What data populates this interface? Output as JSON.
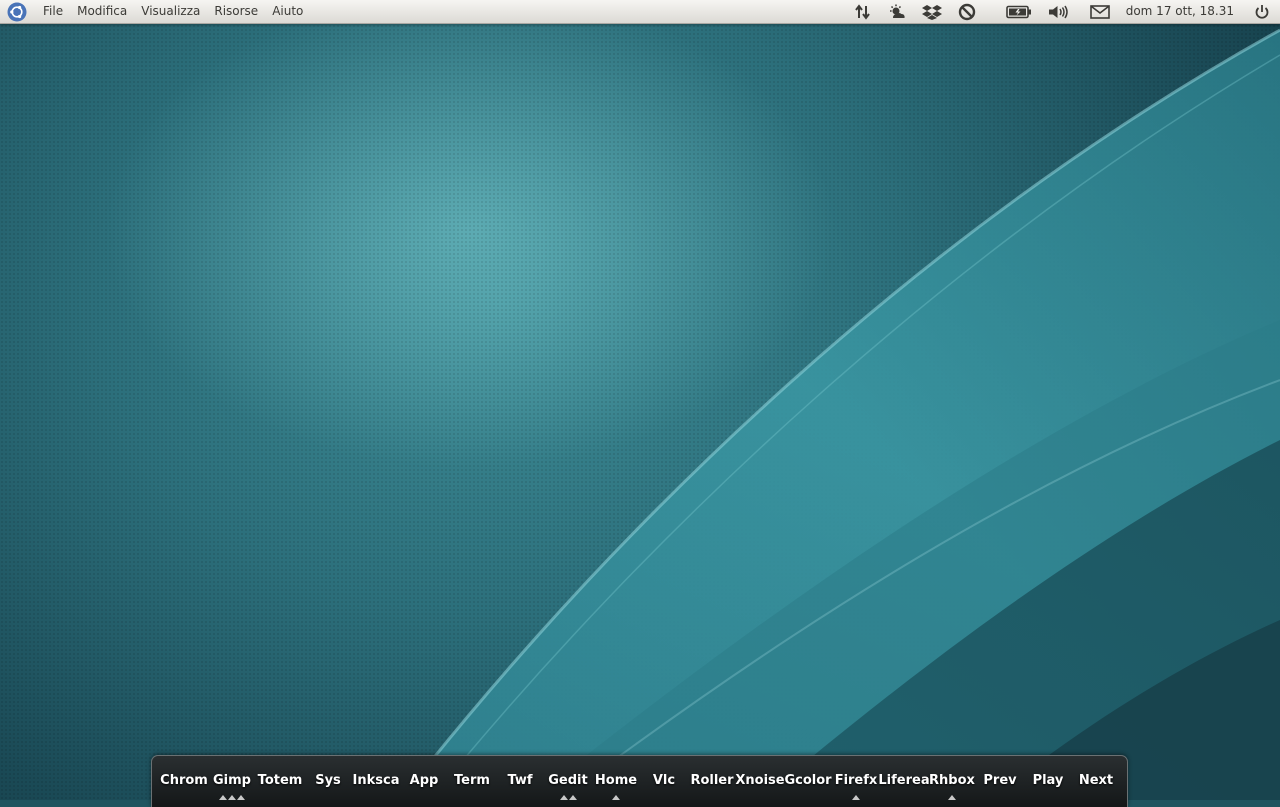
{
  "top_panel": {
    "menus": [
      "File",
      "Modifica",
      "Visualizza",
      "Risorse",
      "Aiuto"
    ],
    "indicators": [
      "network-updown-icon",
      "weather-icon",
      "dropbox-icon",
      "block-icon",
      "battery-icon",
      "volume-icon",
      "mail-icon",
      "power-icon"
    ],
    "clock": "dom 17 ott, 18.31"
  },
  "dock": {
    "items": [
      {
        "label": "Chrom",
        "running": 0
      },
      {
        "label": "Gimp",
        "running": 3
      },
      {
        "label": "Totem",
        "running": 0
      },
      {
        "label": "Sys",
        "running": 0
      },
      {
        "label": "Inksca",
        "running": 0
      },
      {
        "label": "App",
        "running": 0
      },
      {
        "label": "Term",
        "running": 0
      },
      {
        "label": "Twf",
        "running": 0
      },
      {
        "label": "Gedit",
        "running": 2
      },
      {
        "label": "Home",
        "running": 1
      },
      {
        "label": "Vlc",
        "running": 0
      },
      {
        "label": "Roller",
        "running": 0
      },
      {
        "label": "Xnoise",
        "running": 0
      },
      {
        "label": "Gcolor",
        "running": 0
      },
      {
        "label": "Firefx",
        "running": 1
      },
      {
        "label": "Liferea",
        "running": 0
      },
      {
        "label": "Rhbox",
        "running": 1
      },
      {
        "label": "Prev",
        "running": 0
      },
      {
        "label": "Play",
        "running": 0
      },
      {
        "label": "Next",
        "running": 0
      }
    ]
  },
  "colors": {
    "panel_text": "#3c3b37",
    "wallpaper_teal": "#2c6f7b",
    "dock_bg": "#1b1f20"
  }
}
